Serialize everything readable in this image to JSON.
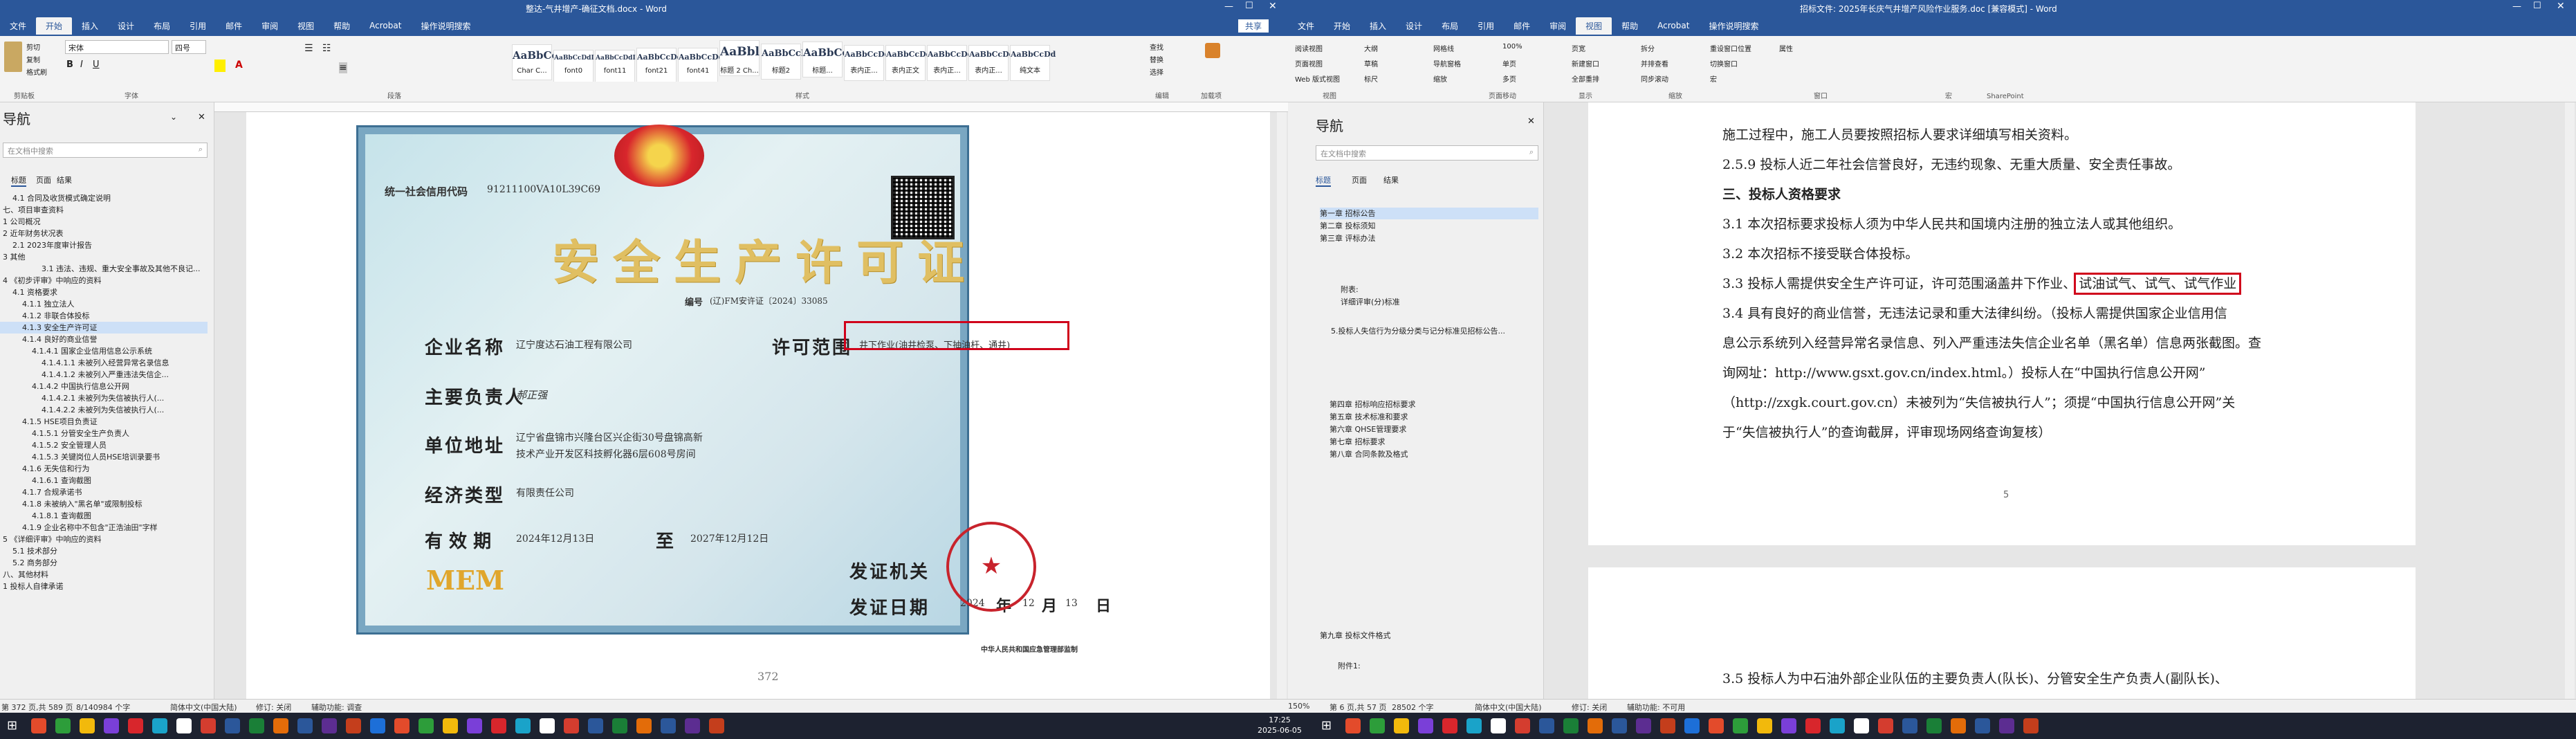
{
  "left": {
    "title": "整达-气井增产-确征文档.docx - Word",
    "tabs": [
      "文件",
      "开始",
      "插入",
      "设计",
      "布局",
      "引用",
      "邮件",
      "审阅",
      "视图",
      "帮助",
      "Acrobat",
      "操作说明搜索"
    ],
    "share": "共享",
    "clipboard": {
      "cut": "剪切",
      "copy": "复制",
      "paste": "格式刷",
      "label": "剪贴板"
    },
    "font": {
      "name": "宋体",
      "size": "四号",
      "label": "字体"
    },
    "paragraph_label": "段落",
    "styles": [
      {
        "sample": "AaBbCcI",
        "name": "Char C..."
      },
      {
        "sample": "AaBbCcDdI",
        "name": "font0"
      },
      {
        "sample": "AaBbCcDdI",
        "name": "font11"
      },
      {
        "sample": "AaBbCcDd",
        "name": "font21"
      },
      {
        "sample": "AaBbCcDd",
        "name": "font41"
      },
      {
        "sample": "AaBbl",
        "name": "标题 2 Ch..."
      },
      {
        "sample": "AaBbCcD",
        "name": "标题2"
      },
      {
        "sample": "AaBbCc",
        "name": "标题..."
      },
      {
        "sample": "AaBbCcDd",
        "name": "表内正..."
      },
      {
        "sample": "AaBbCcDd",
        "name": "表内正文"
      },
      {
        "sample": "AaBbCcDd",
        "name": "表内正..."
      },
      {
        "sample": "AaBbCcDd",
        "name": "表内正..."
      },
      {
        "sample": "AaBbCcDd",
        "name": "纯文本"
      }
    ],
    "styles_label": "样式",
    "edit": {
      "find": "查找",
      "replace": "替换",
      "select": "选择",
      "label": "编辑"
    },
    "addin": {
      "label": "加载项"
    },
    "nav": {
      "title": "导航",
      "search_placeholder": "在文档中搜索",
      "tabs": [
        "标题",
        "页面",
        "结果"
      ],
      "items": [
        "4.1 合同及收货模式确定说明",
        "七、项目审查资料",
        "1 公司概况",
        "2 近年财务状况表",
        "2.1 2023年度审计报告",
        "3 其他",
        "3.1 违法、违规、重大安全事故及其他不良记...",
        "4 《初步评审》中响应的资料",
        "4.1 资格要求",
        "4.1.1 独立法人",
        "4.1.2 非联合体投标",
        "4.1.3 安全生产许可证",
        "4.1.4 良好的商业信誉",
        "4.1.4.1 国家企业信用信息公示系统",
        "4.1.4.1.1 未被列入经营异常名录信息",
        "4.1.4.1.2 未被列入严重违法失信企...",
        "4.1.4.2 中国执行信息公开网",
        "4.1.4.2.1 未被列为失信被执行人(...",
        "4.1.4.2.2 未被列为失信被执行人(...",
        "4.1.5 HSE项目负责证",
        "4.1.5.1 分管安全生产负责人",
        "4.1.5.2 安全管理人员",
        "4.1.5.3 关键岗位人员HSE培训录要书",
        "4.1.6 无失信和行为",
        "4.1.6.1 查询截图",
        "4.1.7 合规承诺书",
        "4.1.8 未被纳入\"黑名单\"或限制投标",
        "4.1.8.1 查询截图",
        "4.1.9 企业名称中不包含\"正浩油田\"字样",
        "5 《详细评审》中响应的资料",
        "5.1 技术部分",
        "5.2 商务部分",
        "八、其他材料",
        "1 投标人自律承诺"
      ],
      "selected": 11
    },
    "certificate": {
      "credit_code_label": "统一社会信用代码",
      "credit_code": "91211100VA10L39C69",
      "title": "安全生产许可证",
      "cert_no_label": "编号",
      "cert_no": "(辽)FM安许证〔2024〕33085",
      "company_label": "企业名称",
      "company": "辽宁度达石油工程有限公司",
      "scope_label": "许可范围",
      "scope": "井下作业(油井检泵、下抽油杆、通井)",
      "leader_label": "主要负责人",
      "leader": "郝正强",
      "address_label": "单位地址",
      "address_1": "辽宁省盘锦市兴隆台区兴企街30号盘锦高新",
      "address_2": "技术产业开发区科技孵化器6层608号房间",
      "type_label": "经济类型",
      "type": "有限责任公司",
      "valid_label": "有 效 期",
      "valid_from": "2024年12月13日",
      "to_label": "至",
      "valid_to": "2027年12月12日",
      "issuer_label": "发证机关",
      "issue_date_label": "发证日期",
      "issue_year": "2024",
      "year_char": "年",
      "issue_month": "12",
      "month_char": "月",
      "issue_day": "13",
      "day_char": "日",
      "mem": "MEM",
      "footer": "中华人民共和国应急管理部监制"
    },
    "page_number": "372",
    "status": {
      "page": "第 372 页,共 589 页",
      "words": "8/140984 个字",
      "lang": "简体中文(中国大陆)",
      "track": "修订: 关闭",
      "access": "辅助功能: 调查"
    }
  },
  "right": {
    "title": "招标文件: 2025年长庆气井增产风险作业服务.doc [兼容模式] - Word",
    "tabs": [
      "文件",
      "开始",
      "插入",
      "设计",
      "布局",
      "引用",
      "邮件",
      "审阅",
      "视图",
      "帮助",
      "Acrobat",
      "操作说明搜索"
    ],
    "view_groups": [
      "阅读视图",
      "页面视图",
      "Web 版式视图",
      "大纲",
      "草稿",
      "标尺",
      "网格线",
      "导航窗格",
      "缩放",
      "100%",
      "单页",
      "多页",
      "页宽",
      "新建窗口",
      "全部重排",
      "拆分",
      "并排查看",
      "同步滚动",
      "重设窗口位置",
      "切换窗口",
      "宏",
      "属性"
    ],
    "view_labels": [
      "视图",
      "页面移动",
      "显示",
      "缩放",
      "窗口",
      "宏",
      "SharePoint"
    ],
    "nav": {
      "title": "导航",
      "search_placeholder": "在文档中搜索",
      "tabs": [
        "标题",
        "页面",
        "结果"
      ],
      "items_top": [
        "第一章 招标公告",
        "第二章 投标须知",
        "第三章 评标办法"
      ],
      "attach": "附表:",
      "attach_item": "详细评审(分)标准",
      "item5": "5.投标人失信行为分级分类与记分标准见招标公告...",
      "items_mid": [
        "第四章 招标响应招标要求",
        "第五章 技术标准和要求",
        "第六章 QHSE管理要求",
        "第七章 招标要求",
        "第八章 合同条款及格式"
      ],
      "items_bottom": [
        "第九章 投标文件格式",
        "附件1:"
      ]
    },
    "doc": {
      "lines": [
        "施工过程中，施工人员要按照招标人要求详细填写相关资料。",
        "2.5.9 投标人近二年社会信誉良好，无违约现象、无重大质量、安全责任事故。",
        "三、投标人资格要求",
        "3.1 本次招标要求投标人须为中华人民共和国境内注册的独立法人或其他组织。",
        "3.2 本次招标不接受联合体投标。",
        "3.3 投标人需提供安全生产许可证，许可范围涵盖井下作业、",
        "3.4 具有良好的商业信誉，无违法记录和重大法律纠纷。（投标人需提供国家企业信用信",
        "息公示系统列入经营异常名录信息、列入严重违法失信企业名单（黑名单）信息两张截图。查",
        "询网址：http://www.gsxt.gov.cn/index.html。）投标人在“中国执行信息公开网”",
        "（http://zxgk.court.gov.cn）未被列为“失信被执行人”；须提“中国执行信息公开网”关",
        "于“失信被执行人”的查询截屏，评审现场网络查询复核）"
      ],
      "highlight": "试油试气、试气、试气作业",
      "page_num": "5",
      "next_line": "3.5 投标人为中石油外部企业队伍的主要负责人(队长)、分管安全生产负责人(副队长)、"
    },
    "status": {
      "page": "第 6 页,共 57 页",
      "words": "28502 个字",
      "lang": "简体中文(中国大陆)",
      "track": "修订: 关闭",
      "access": "辅助功能: 不可用",
      "zoom": "150%"
    }
  },
  "taskbar": {
    "time": "17:25",
    "date": "2025-06-05"
  }
}
